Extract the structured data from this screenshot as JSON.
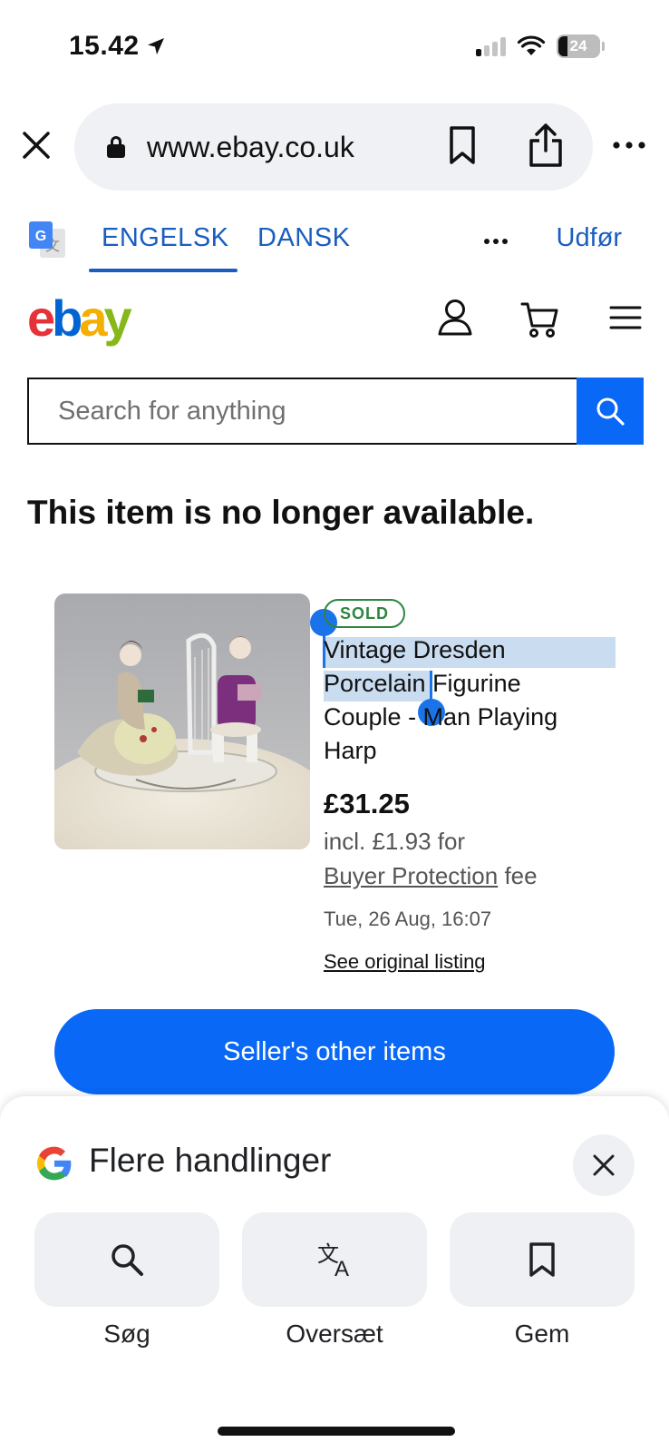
{
  "status_bar": {
    "time": "15.42",
    "battery": "24"
  },
  "browser": {
    "url": "www.ebay.co.uk"
  },
  "translate_bar": {
    "source_lang": "ENGELSK",
    "target_lang": "DANSK",
    "action": "Udfør"
  },
  "ebay": {
    "logo": {
      "e": "e",
      "b": "b",
      "a": "a",
      "y": "y"
    },
    "search_placeholder": "Search for anything",
    "page_title": "This item is no longer available.",
    "item": {
      "badge": "SOLD",
      "title_selected_1": "Vintage Dresden",
      "title_selected_2": "Porcelain",
      "title_rest_1": " Figurine",
      "title_rest_2": "Couple - Man Playing",
      "title_rest_3": "Harp",
      "price": "£31.25",
      "price_note_prefix": "incl. £1.93 for",
      "price_note_link": "Buyer Protection",
      "price_note_suffix": " fee",
      "date": "Tue, 26 Aug, 16:07",
      "original_link": "See original listing"
    },
    "seller_button": "Seller's other items"
  },
  "sheet": {
    "title": "Flere handlinger",
    "actions": [
      {
        "label": "Søg",
        "icon": "search-icon"
      },
      {
        "label": "Oversæt",
        "icon": "translate-icon"
      },
      {
        "label": "Gem",
        "icon": "bookmark-icon"
      }
    ]
  },
  "colors": {
    "accent": "#0968f6",
    "translate_blue": "#1a5ec0",
    "sold_green": "#2e8540",
    "selection": "#c9dcf0"
  }
}
